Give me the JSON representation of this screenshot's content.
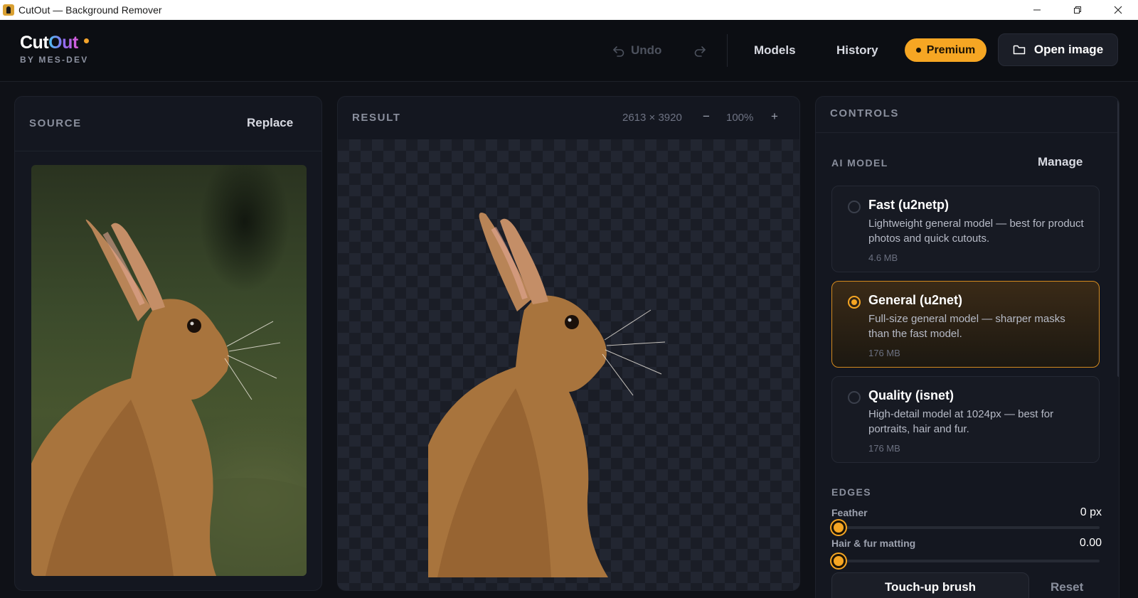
{
  "window": {
    "title": "CutOut — Background Remover"
  },
  "logo": {
    "cut": "Cut",
    "out": "Out",
    "sub": "BY MES-DEV"
  },
  "header": {
    "undo_label": "Undo",
    "models_label": "Models",
    "history_label": "History",
    "premium_label": "Premium",
    "open_image_label": "Open image"
  },
  "source": {
    "label": "SOURCE",
    "replace_label": "Replace"
  },
  "result": {
    "label": "RESULT",
    "dimensions": "2613 × 3920",
    "zoom_out": "−",
    "zoom": "100%",
    "zoom_in": "+"
  },
  "controls": {
    "label": "CONTROLS",
    "ai_model_label": "AI MODEL",
    "manage_label": "Manage",
    "models": [
      {
        "name": "Fast (u2netp)",
        "description": "Lightweight general model — best for product photos and quick cutouts.",
        "size": "4.6 MB",
        "selected": false
      },
      {
        "name": "General (u2net)",
        "description": "Full-size general model — sharper masks than the fast model.",
        "size": "176 MB",
        "selected": true
      },
      {
        "name": "Quality (isnet)",
        "description": "High-detail model at 1024px — best for portraits, hair and fur.",
        "size": "176 MB",
        "selected": false
      }
    ],
    "edges_label": "EDGES",
    "feather": {
      "label": "Feather",
      "value": "0 px",
      "level": 0
    },
    "matting": {
      "label": "Hair & fur matting",
      "value": "0.00",
      "level": 0
    },
    "touchup_label": "Touch-up brush",
    "reset_label": "Reset"
  },
  "colors": {
    "accent": "#f6a623",
    "background": "#0f1117",
    "panel": "#141720"
  }
}
